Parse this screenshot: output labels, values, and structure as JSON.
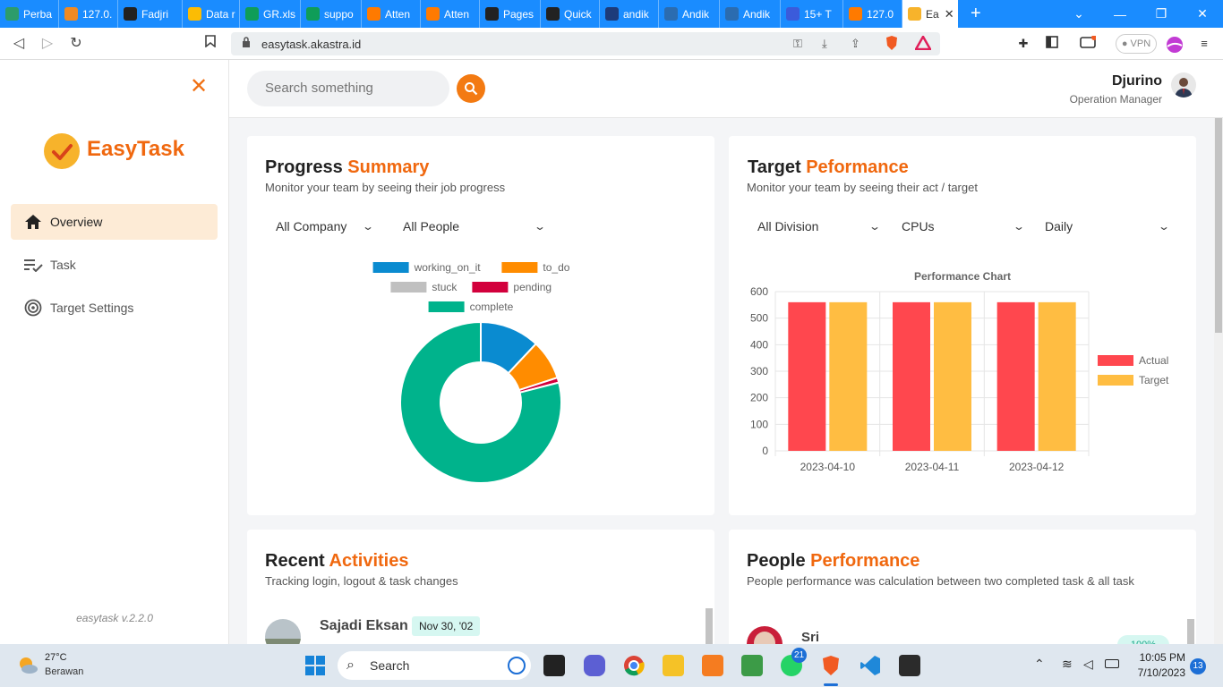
{
  "browser": {
    "tabs": [
      {
        "label": "Perba",
        "color": "#2d9c6a"
      },
      {
        "label": "127.0.",
        "color": "#f08a24"
      },
      {
        "label": "Fadjri",
        "color": "#222222"
      },
      {
        "label": "Data r",
        "color": "#fbbc04"
      },
      {
        "label": "GR.xls",
        "color": "#0f9d58"
      },
      {
        "label": "suppo",
        "color": "#0f9d58"
      },
      {
        "label": "Atten",
        "color": "#ff7a00"
      },
      {
        "label": "Atten",
        "color": "#ff7a00"
      },
      {
        "label": "Pages",
        "color": "#222222"
      },
      {
        "label": "Quick",
        "color": "#222222"
      },
      {
        "label": "andik",
        "color": "#1d3b7a"
      },
      {
        "label": "Andik",
        "color": "#2b6cb0"
      },
      {
        "label": "Andik",
        "color": "#2b6cb0"
      },
      {
        "label": "15+ T",
        "color": "#3b5bdb"
      },
      {
        "label": "127.0",
        "color": "#ff7a00"
      },
      {
        "label": "Ea",
        "color": "#f7b32b",
        "active": true
      }
    ],
    "url": "easytask.akastra.id",
    "vpn_label": "VPN"
  },
  "sidebar": {
    "logo_text": "EasyTask",
    "items": [
      {
        "label": "Overview",
        "icon": "home-icon"
      },
      {
        "label": "Task",
        "icon": "task-list-icon"
      },
      {
        "label": "Target Settings",
        "icon": "target-icon"
      }
    ],
    "version": "easytask v.2.2.0"
  },
  "header": {
    "search_placeholder": "Search something",
    "user_name": "Djurino",
    "user_role": "Operation Manager"
  },
  "progress_card": {
    "title_main": "Progress",
    "title_accent": "Summary",
    "subtitle": "Monitor your team by seeing their job progress",
    "company_select": "All Company",
    "people_select": "All People"
  },
  "target_card": {
    "title_main": "Target",
    "title_accent": "Peformance",
    "subtitle": "Monitor your team by seeing their act / target",
    "division_select": "All Division",
    "metric_select": "CPUs",
    "period_select": "Daily"
  },
  "activities_card": {
    "title_main": "Recent",
    "title_accent": "Activities",
    "subtitle": "Tracking login, logout & task changes",
    "first_name": "Sajadi Eksan",
    "first_date": "Nov 30, '02"
  },
  "people_card": {
    "title_main": "People",
    "title_accent": "Performance",
    "subtitle": "People performance was calculation between two completed task & all task",
    "first_name": "Sri",
    "first_badge": "100%"
  },
  "chart_data": [
    {
      "type": "pie",
      "donut": true,
      "legend_position": "top",
      "labels": [
        "working_on_it",
        "to_do",
        "stuck",
        "pending",
        "complete"
      ],
      "colors": [
        "#0a8bd0",
        "#ff8c00",
        "#c0c0c0",
        "#d2003c",
        "#00b38c"
      ],
      "values": [
        12,
        8,
        0,
        1,
        79
      ]
    },
    {
      "type": "bar",
      "title": "Performance Chart",
      "categories": [
        "2023-04-10",
        "2023-04-11",
        "2023-04-12"
      ],
      "series": [
        {
          "name": "Actual",
          "color": "#ff474e",
          "values": [
            560,
            560,
            560
          ]
        },
        {
          "name": "Target",
          "color": "#ffbd42",
          "values": [
            560,
            560,
            560
          ]
        }
      ],
      "ylim": [
        0,
        600
      ],
      "yticks": [
        0,
        100,
        200,
        300,
        400,
        500,
        600
      ],
      "grid": true,
      "legend_position": "right"
    }
  ],
  "taskbar": {
    "weather_temp": "27°C",
    "weather_text": "Berawan",
    "search_label": "Search",
    "whatsapp_badge": "21",
    "time": "10:05 PM",
    "date": "7/10/2023",
    "notif_count": "13"
  }
}
